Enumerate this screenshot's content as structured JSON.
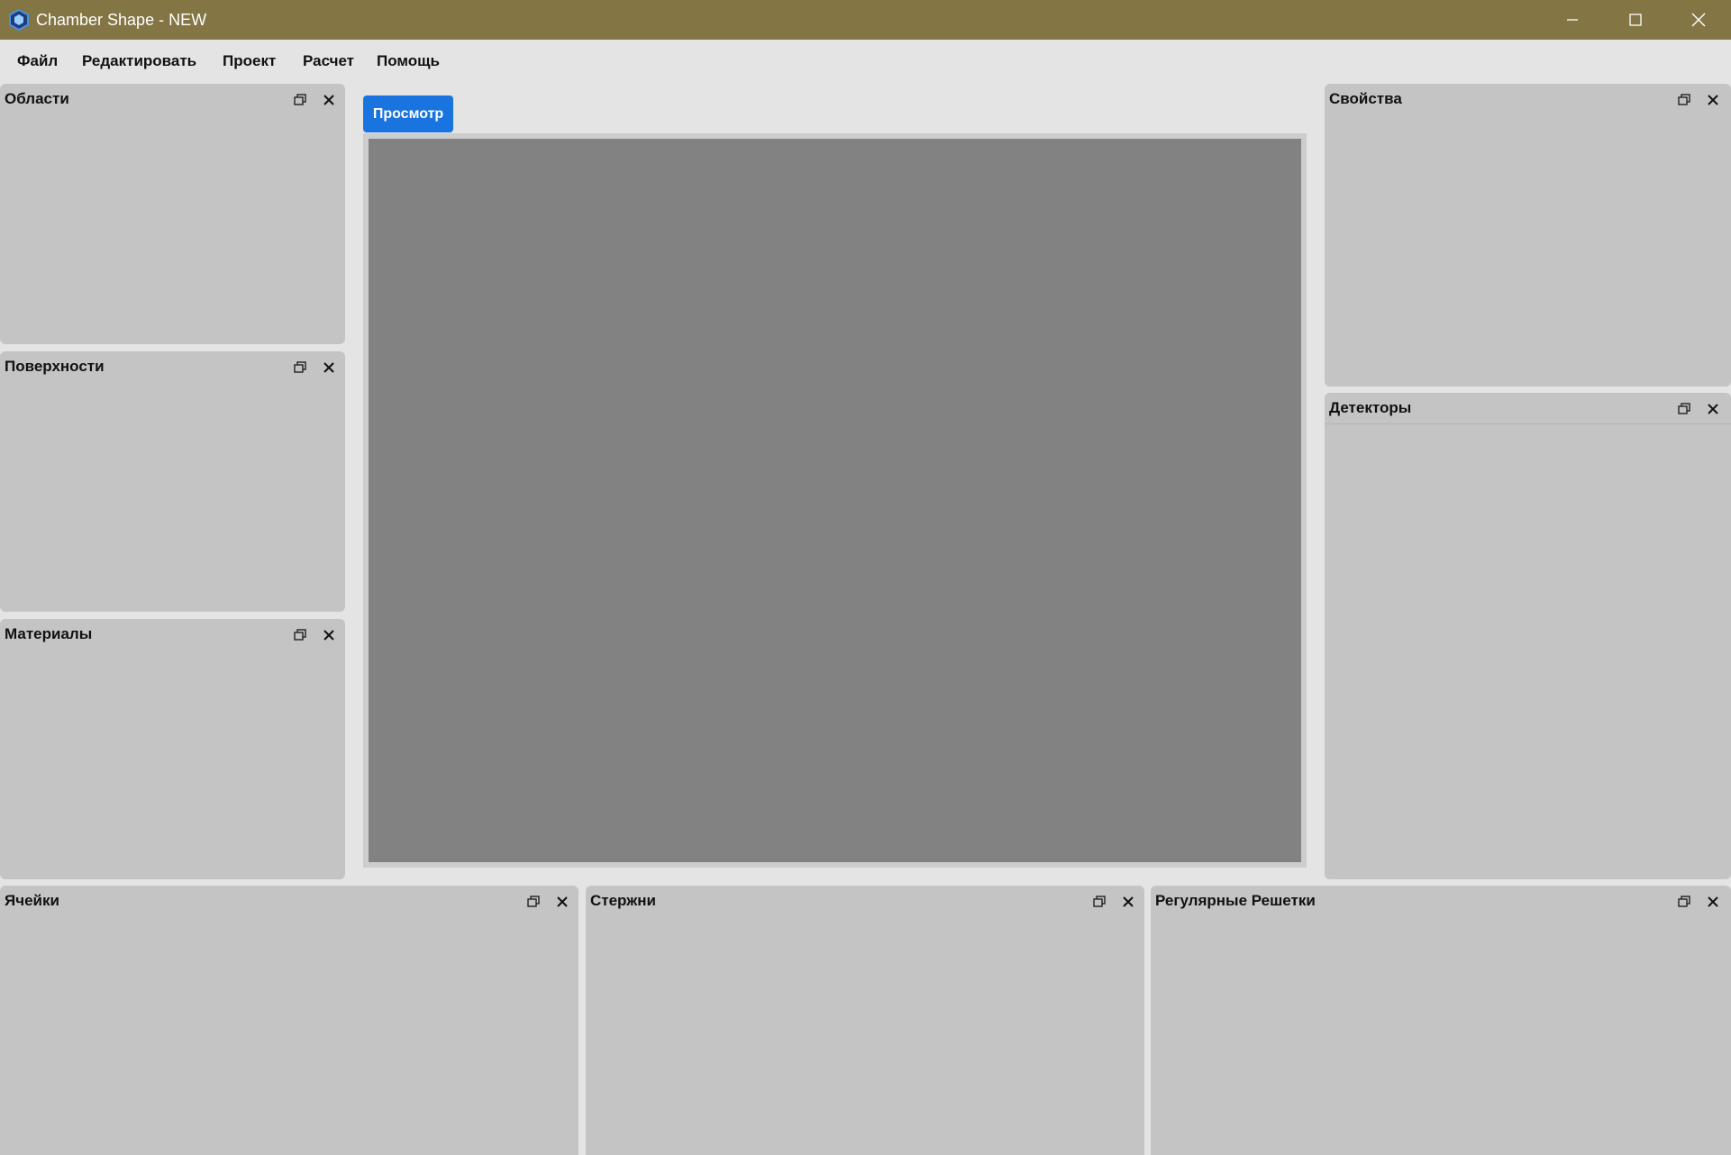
{
  "window": {
    "title": "Chamber Shape - NEW",
    "icons": {
      "app": "app-hexagon-icon",
      "minimize": "minimize-icon",
      "maximize": "maximize-icon",
      "close": "close-icon"
    }
  },
  "menu": {
    "file": "Файл",
    "edit": "Редактировать",
    "project": "Проект",
    "calc": "Расчет",
    "help": "Помощь"
  },
  "tabs": {
    "view": "Просмотр"
  },
  "panels": {
    "areas": "Области",
    "surfaces": "Поверхности",
    "materials": "Материалы",
    "properties": "Свойства",
    "detectors": "Детекторы",
    "cells": "Ячейки",
    "rods": "Стержни",
    "lattices": "Регулярные Решетки"
  },
  "colors": {
    "titlebar": "#837544",
    "accent": "#1a74e0",
    "panel": "#c4c4c4",
    "viewport": "#828282"
  }
}
